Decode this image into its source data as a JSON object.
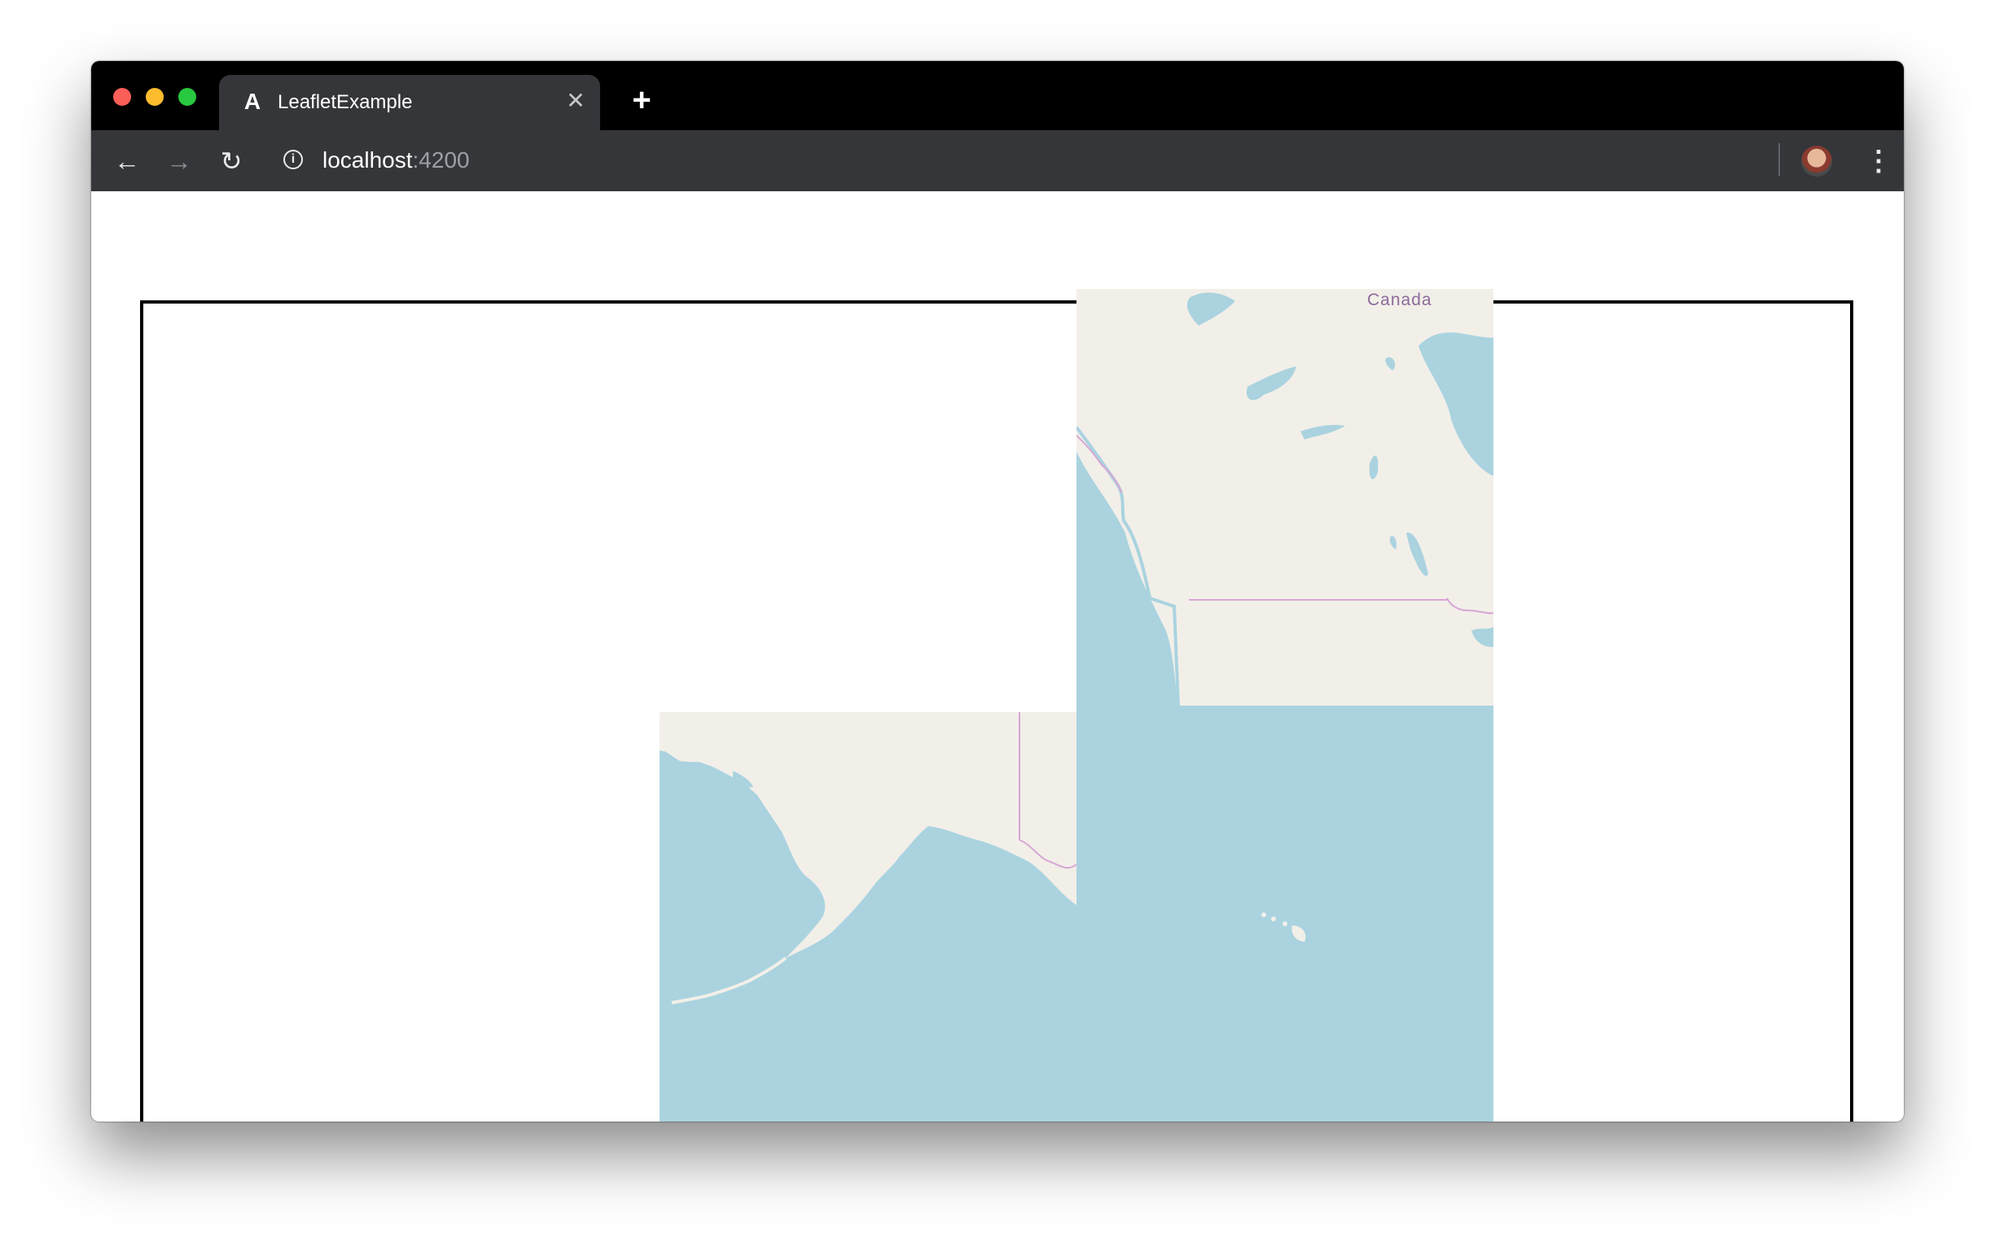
{
  "browser": {
    "tab": {
      "favicon": "A",
      "title": "LeafletExample",
      "close_label": "✕"
    },
    "new_tab_label": "+",
    "toolbar": {
      "back_icon": "←",
      "forward_icon": "→",
      "reload_icon": "↻",
      "info_icon": "i",
      "url_host": "localhost",
      "url_port": ":4200",
      "menu_icon": "⋮"
    }
  },
  "map": {
    "labels": {
      "canada": "Canada"
    },
    "colors": {
      "water": "#aad3df",
      "land": "#f2efe9",
      "border": "#d7a7d5"
    }
  }
}
